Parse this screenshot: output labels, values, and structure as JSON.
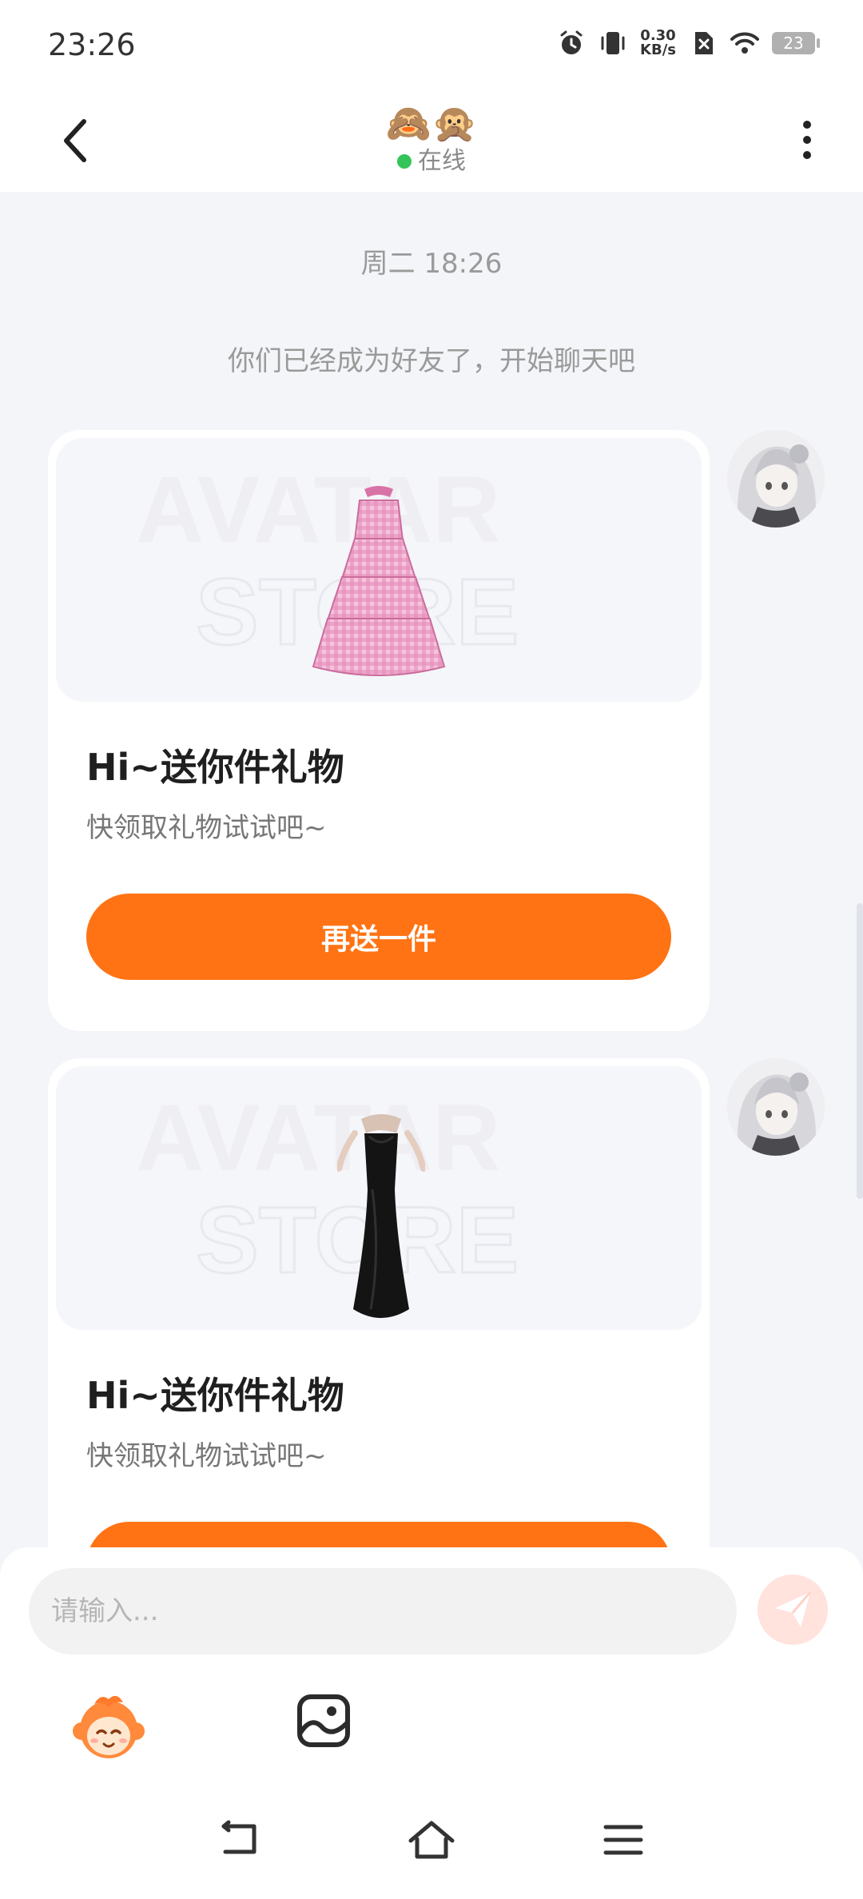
{
  "status_bar": {
    "time": "23:26",
    "net_speed_value": "0.30",
    "net_speed_unit": "KB/s",
    "battery": "23"
  },
  "header": {
    "title": "🙈🙊",
    "status": "在线"
  },
  "chat": {
    "timestamp": "周二 18:26",
    "system_message": "你们已经成为好友了，开始聊天吧",
    "watermark_top": "AVATAR",
    "watermark_bottom": "STORE",
    "messages": [
      {
        "title": "Hi~送你件礼物",
        "subtitle": "快领取礼物试试吧~",
        "button_label": "再送一件",
        "gift_icon": "pink-gingham-dress"
      },
      {
        "title": "Hi~送你件礼物",
        "subtitle": "快领取礼物试试吧~",
        "button_label": "",
        "gift_icon": "black-evening-gown"
      }
    ]
  },
  "input_bar": {
    "placeholder": "请输入...",
    "send_icon": "paper-plane-icon"
  },
  "tools": [
    "monkey-emoji-icon",
    "image-icon"
  ],
  "nav": [
    "back-icon",
    "home-icon",
    "menu-icon"
  ],
  "colors": {
    "accent": "#ff7314",
    "online": "#33c55a",
    "background": "#f3f5f8",
    "send_disabled": "#ffe3dc"
  }
}
